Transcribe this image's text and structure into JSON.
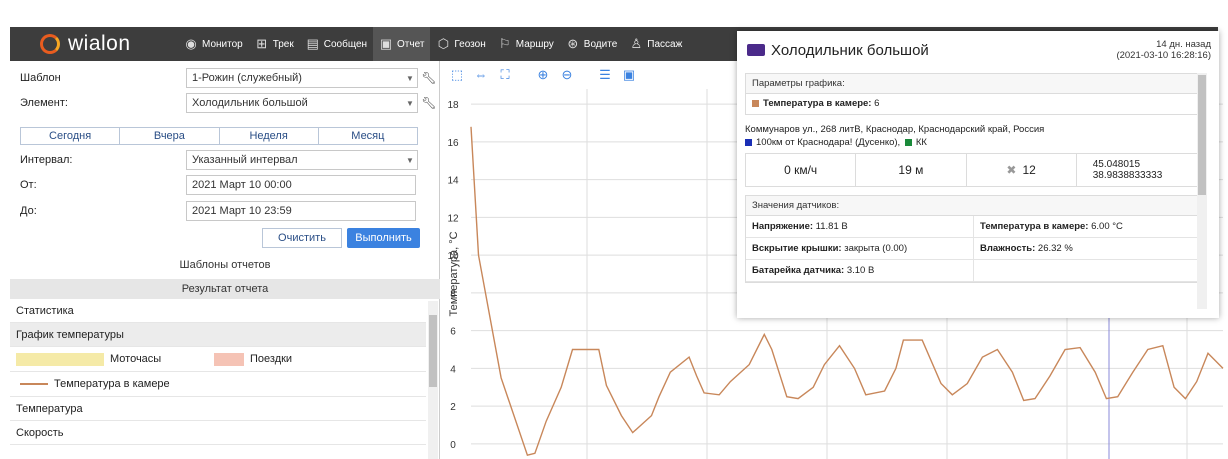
{
  "app": {
    "logo": "wialon"
  },
  "nav": [
    {
      "label": "Монитор",
      "icon": "eye-icon",
      "glyph": "◉"
    },
    {
      "label": "Трек",
      "icon": "track-icon",
      "glyph": "⊞"
    },
    {
      "label": "Сообщен",
      "icon": "messages-icon",
      "glyph": "▤"
    },
    {
      "label": "Отчет",
      "icon": "reports-icon",
      "glyph": "▣"
    },
    {
      "label": "Геозон",
      "icon": "geofence-icon",
      "glyph": "⬡"
    },
    {
      "label": "Маршру",
      "icon": "routes-icon",
      "glyph": "⚐"
    },
    {
      "label": "Водите",
      "icon": "drivers-icon",
      "glyph": "⊛"
    },
    {
      "label": "Пассаж",
      "icon": "passengers-icon",
      "glyph": "♙"
    }
  ],
  "form": {
    "template_label": "Шаблон",
    "template_value": "1-Рожин (служебный)",
    "element_label": "Элемент:",
    "element_value": "Холодильник большой",
    "quick": [
      "Сегодня",
      "Вчера",
      "Неделя",
      "Месяц"
    ],
    "interval_label": "Интервал:",
    "interval_value": "Указанный интервал",
    "from_label": "От:",
    "from_value": "2021 Март 10 00:00",
    "to_label": "До:",
    "to_value": "2021 Март 10 23:59",
    "clear_label": "Очистить",
    "run_label": "Выполнить"
  },
  "report": {
    "templates_title": "Шаблоны отчетов",
    "result_title": "Результат отчета",
    "items": {
      "stats": "Статистика",
      "temp_chart": "График температуры",
      "engine_hours": "Моточасы",
      "trips": "Поездки",
      "temp_series": "Температура в камере",
      "temperature": "Температура",
      "speed": "Скорость"
    },
    "colors": {
      "engine_hours": "#f5eaa7",
      "trips": "#f5c3b5",
      "series": "#c8875a"
    }
  },
  "popup": {
    "title": "Холодильник большой",
    "ago": "14 дн. назад",
    "timestamp": "(2021-03-10 16:28:16)",
    "params_title": "Параметры графика:",
    "param_label": "Температура в камере:",
    "param_value": "6",
    "address": "Коммунаров ул., 268 литВ, Краснодар, Краснодарский край, Россия",
    "zone1": "100км от Краснодара! (Дусенко),",
    "zone2": "КК",
    "speed": "0 км/ч",
    "altitude": "19 м",
    "satellites": "12",
    "lat": "45.048015",
    "lon": "38.9838833333",
    "sensors_title": "Значения датчиков:",
    "sensors": [
      {
        "label": "Напряжение:",
        "value": "11.81 В"
      },
      {
        "label": "Температура в камере:",
        "value": "6.00 °C"
      },
      {
        "label": "Вскрытие крышки:",
        "value": "закрыта (0.00)"
      },
      {
        "label": "Влажность:",
        "value": "26.32 %"
      },
      {
        "label": "Батарейка датчика:",
        "value": "3.10 В"
      },
      {
        "label": "",
        "value": ""
      }
    ]
  },
  "chart_data": {
    "type": "line",
    "ylabel": "Температура, °C",
    "yticks": [
      0,
      2,
      4,
      6,
      8,
      10,
      12,
      14,
      16,
      18
    ],
    "ylim": [
      -0.8,
      18.8
    ],
    "xlim": [
      0,
      1
    ],
    "grid": true,
    "series": [
      {
        "name": "Температура в камере",
        "color": "#c8875a",
        "x": [
          0.0,
          0.01,
          0.04,
          0.075,
          0.085,
          0.1,
          0.12,
          0.135,
          0.17,
          0.18,
          0.2,
          0.215,
          0.24,
          0.25,
          0.265,
          0.29,
          0.3,
          0.31,
          0.33,
          0.345,
          0.37,
          0.39,
          0.4,
          0.42,
          0.435,
          0.455,
          0.47,
          0.49,
          0.51,
          0.525,
          0.55,
          0.565,
          0.575,
          0.6,
          0.625,
          0.64,
          0.66,
          0.68,
          0.7,
          0.72,
          0.735,
          0.75,
          0.77,
          0.79,
          0.81,
          0.83,
          0.845,
          0.86,
          0.88,
          0.9,
          0.92,
          0.935,
          0.95,
          0.965,
          0.98,
          1.0
        ],
        "values": [
          16.8,
          10.0,
          3.5,
          -0.6,
          -0.5,
          1.2,
          3.0,
          5.0,
          5.0,
          3.1,
          1.5,
          0.6,
          1.5,
          2.5,
          3.8,
          4.6,
          3.6,
          2.7,
          2.6,
          3.3,
          4.2,
          5.8,
          5.0,
          2.5,
          2.4,
          3.0,
          4.2,
          5.2,
          4.0,
          2.6,
          2.8,
          4.0,
          5.5,
          5.5,
          3.2,
          2.6,
          3.2,
          4.6,
          5.0,
          3.8,
          2.3,
          2.4,
          3.6,
          5.0,
          5.1,
          3.8,
          2.4,
          2.5,
          3.8,
          5.0,
          5.2,
          3.0,
          2.4,
          3.3,
          4.8,
          4.0
        ]
      }
    ]
  }
}
